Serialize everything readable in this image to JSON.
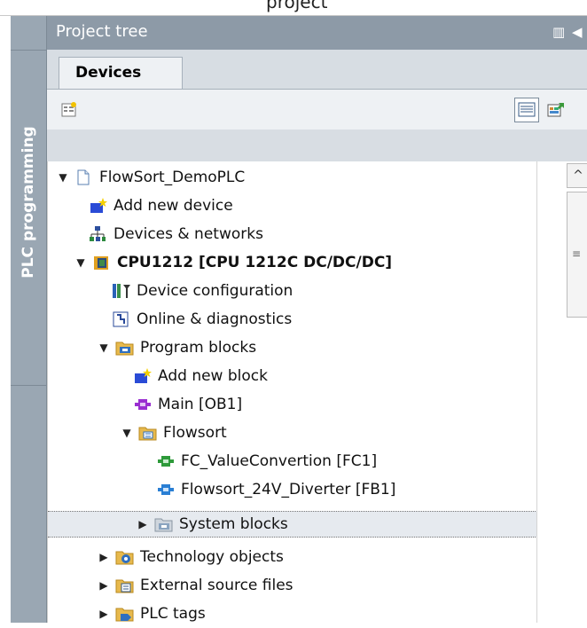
{
  "window": {
    "top_fragment": "project"
  },
  "sidebar": {
    "vertical_tab_label": "PLC programming"
  },
  "panel": {
    "title": "Project tree",
    "pin_glyph": "▥",
    "collapse_glyph": "◀"
  },
  "tabs": [
    {
      "label": "Devices"
    }
  ],
  "tree": {
    "items": [
      {
        "label": "FlowSort_DemoPLC",
        "icon": "project-file-icon",
        "expanded": true
      },
      {
        "label": "Add new device",
        "icon": "add-new-device-icon"
      },
      {
        "label": "Devices & networks",
        "icon": "network-icon"
      },
      {
        "label": "CPU1212 [CPU 1212C DC/DC/DC]",
        "icon": "cpu-icon",
        "expanded": true
      },
      {
        "label": "Device configuration",
        "icon": "device-config-icon"
      },
      {
        "label": "Online & diagnostics",
        "icon": "diagnostics-icon"
      },
      {
        "label": "Program blocks",
        "icon": "folder-blocks-icon",
        "expanded": true
      },
      {
        "label": "Add new block",
        "icon": "add-new-block-icon"
      },
      {
        "label": "Main [OB1]",
        "icon": "ob-block-icon"
      },
      {
        "label": "Flowsort",
        "icon": "group-folder-icon",
        "expanded": true
      },
      {
        "label": "FC_ValueConvertion [FC1]",
        "icon": "fc-block-icon"
      },
      {
        "label": "Flowsort_24V_Diverter [FB1]",
        "icon": "fb-block-icon"
      },
      {
        "label": "System blocks",
        "icon": "system-folder-icon",
        "expanded": false,
        "selected": true
      },
      {
        "label": "Technology objects",
        "icon": "technology-icon",
        "expanded": false
      },
      {
        "label": "External source files",
        "icon": "external-source-icon",
        "expanded": false
      },
      {
        "label": "PLC tags",
        "icon": "plc-tags-icon",
        "expanded": false
      }
    ]
  },
  "colors": {
    "panel_header": "#8d9aa7",
    "vertical_tab": "#9aa7b3",
    "tab_area": "#d7dde3",
    "toolbar": "#eef1f4",
    "selection": "#e6eaef"
  }
}
